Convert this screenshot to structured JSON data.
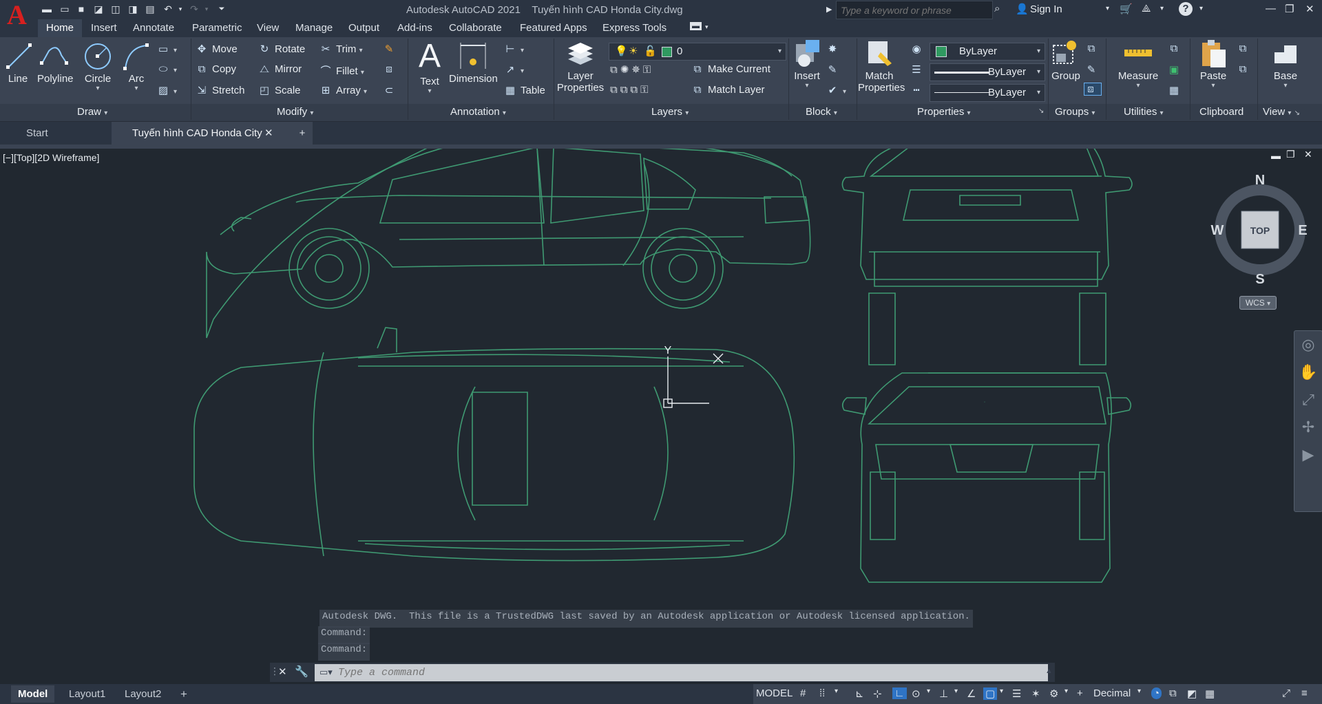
{
  "app": {
    "title": "Autodesk AutoCAD 2021    Tuyến hình CAD Honda City.dwg",
    "logo_letter": "A",
    "search_placeholder": "Type a keyword or phrase",
    "sign_in": "Sign In",
    "help_glyph": "?"
  },
  "ribbon_tabs": [
    "Home",
    "Insert",
    "Annotate",
    "Parametric",
    "View",
    "Manage",
    "Output",
    "Add-ins",
    "Collaborate",
    "Featured Apps",
    "Express Tools"
  ],
  "draw": {
    "line": "Line",
    "polyline": "Polyline",
    "circle": "Circle",
    "arc": "Arc",
    "panel": "Draw"
  },
  "modify": {
    "move": "Move",
    "rotate": "Rotate",
    "trim": "Trim",
    "copy": "Copy",
    "mirror": "Mirror",
    "fillet": "Fillet",
    "stretch": "Stretch",
    "scale": "Scale",
    "array": "Array",
    "panel": "Modify"
  },
  "annotation": {
    "text": "Text",
    "dimension": "Dimension",
    "table": "Table",
    "panel": "Annotation"
  },
  "layers": {
    "layer_properties_1": "Layer",
    "layer_properties_2": "Properties",
    "current_layer": "0",
    "make_current": "Make Current",
    "match_layer": "Match Layer",
    "panel": "Layers"
  },
  "block": {
    "insert": "Insert",
    "panel": "Block"
  },
  "properties": {
    "match_1": "Match",
    "match_2": "Properties",
    "color": "ByLayer",
    "linetype": "ByLayer",
    "lineweight": "ByLayer",
    "panel": "Properties"
  },
  "groups": {
    "group": "Group",
    "panel": "Groups"
  },
  "utilities": {
    "measure": "Measure",
    "panel": "Utilities"
  },
  "clipboard": {
    "paste": "Paste",
    "panel": "Clipboard"
  },
  "view_panel": {
    "base": "Base",
    "panel": "View"
  },
  "doc_tabs": {
    "start": "Start",
    "active": "Tuyến hình CAD Honda City"
  },
  "viewport": {
    "label": "[−][Top][2D Wireframe]",
    "ucs_y": "Y"
  },
  "viewcube": {
    "n": "N",
    "s": "S",
    "e": "E",
    "w": "W",
    "face": "TOP",
    "wcs": "WCS"
  },
  "command": {
    "history": [
      "Autodesk DWG.  This file is a TrustedDWG last saved by an Autodesk application or Autodesk licensed application.",
      "Command:",
      "Command:"
    ],
    "placeholder": "Type a command"
  },
  "layout_tabs": [
    "Model",
    "Layout1",
    "Layout2"
  ],
  "status": {
    "model": "MODEL",
    "units": "Decimal"
  },
  "colors": {
    "drawing_line": "#3f9a72",
    "bg": "#212830",
    "ribbon": "#3b4453",
    "accent_blue": "#2f74c5"
  }
}
